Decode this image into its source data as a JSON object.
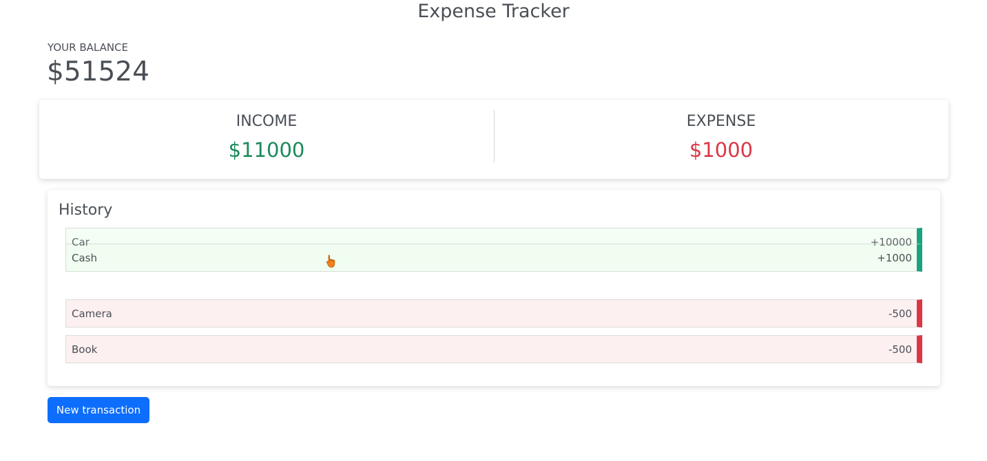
{
  "header": {
    "title": "Expense Tracker"
  },
  "balance": {
    "label": "YOUR BALANCE",
    "amount": "$51524"
  },
  "summary": {
    "income": {
      "label": "INCOME",
      "amount": "$11000",
      "color": "#1b8a5a"
    },
    "expense": {
      "label": "EXPENSE",
      "amount": "$1000",
      "color": "#dc3545"
    }
  },
  "history": {
    "title": "History",
    "transactions": [
      {
        "name": "Car",
        "amount": "+10000",
        "type": "income",
        "state": "dragging"
      },
      {
        "name": "Cash",
        "amount": "+1000",
        "type": "income"
      },
      {
        "name": "Camera",
        "amount": "-500",
        "type": "expense"
      },
      {
        "name": "Book",
        "amount": "-500",
        "type": "expense"
      }
    ]
  },
  "actions": {
    "new_transaction_label": "New transaction"
  },
  "colors": {
    "income_accent": "#1aa37e",
    "expense_accent": "#dc3545",
    "primary": "#0d6efd"
  },
  "icons": {
    "cursor": "hand-pointer-icon"
  }
}
